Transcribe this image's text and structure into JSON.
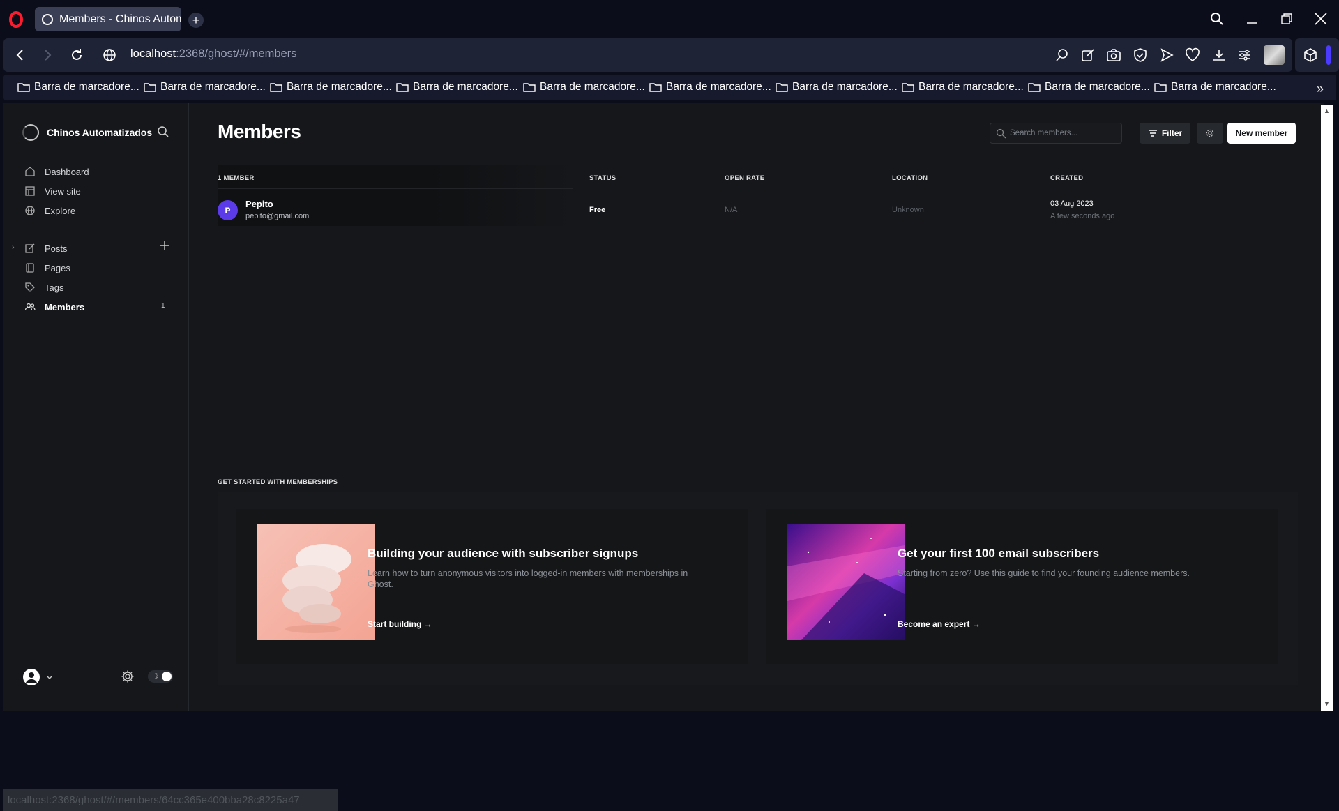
{
  "browser": {
    "tab_title": "Members - Chinos Automatizados",
    "url_host": "localhost",
    "url_rest": ":2368/ghost/#/members",
    "bookmark_label": "Barra de marcadore...",
    "bookmarks": [
      "Barra de marcadore...",
      "Barra de marcadore...",
      "Barra de marcadore...",
      "Barra de marcadore...",
      "Barra de marcadore...",
      "Barra de marcadore...",
      "Barra de marcadore...",
      "Barra de marcadore...",
      "Barra de marcadore...",
      "Barra de marcadore..."
    ],
    "status_url": "localhost:2368/ghost/#/members/64cc365e400bba28c8225a47"
  },
  "sidebar": {
    "brand": "Chinos Automatizados",
    "nav": {
      "dashboard": "Dashboard",
      "view_site": "View site",
      "explore": "Explore",
      "posts": "Posts",
      "pages": "Pages",
      "tags": "Tags",
      "members": "Members"
    },
    "members_count": "1"
  },
  "main": {
    "title": "Members",
    "search_placeholder": "Search members...",
    "filter_label": "Filter",
    "new_member_label": "New member",
    "table": {
      "headers": {
        "member": "1 MEMBER",
        "status": "STATUS",
        "open_rate": "OPEN RATE",
        "location": "LOCATION",
        "created": "CREATED"
      },
      "rows": [
        {
          "initial": "P",
          "name": "Pepito",
          "email": "pepito@gmail.com",
          "status": "Free",
          "open_rate": "N/A",
          "location": "Unknown",
          "created": "03 Aug 2023",
          "created_ago": "A few seconds ago"
        }
      ]
    },
    "get_started": {
      "title": "GET STARTED WITH MEMBERSHIPS",
      "cards": [
        {
          "title": "Building your audience with subscriber signups",
          "description": "Learn how to turn anonymous visitors into logged-in members with memberships in Ghost.",
          "link": "Start building →"
        },
        {
          "title": "Get your first 100 email subscribers",
          "description": "Starting from zero? Use this guide to find your founding audience members.",
          "link": "Become an expert →"
        }
      ]
    }
  },
  "colors": {
    "accent": "#5b3be8",
    "background": "#15171a",
    "browser_bg": "#0b0d1a"
  }
}
